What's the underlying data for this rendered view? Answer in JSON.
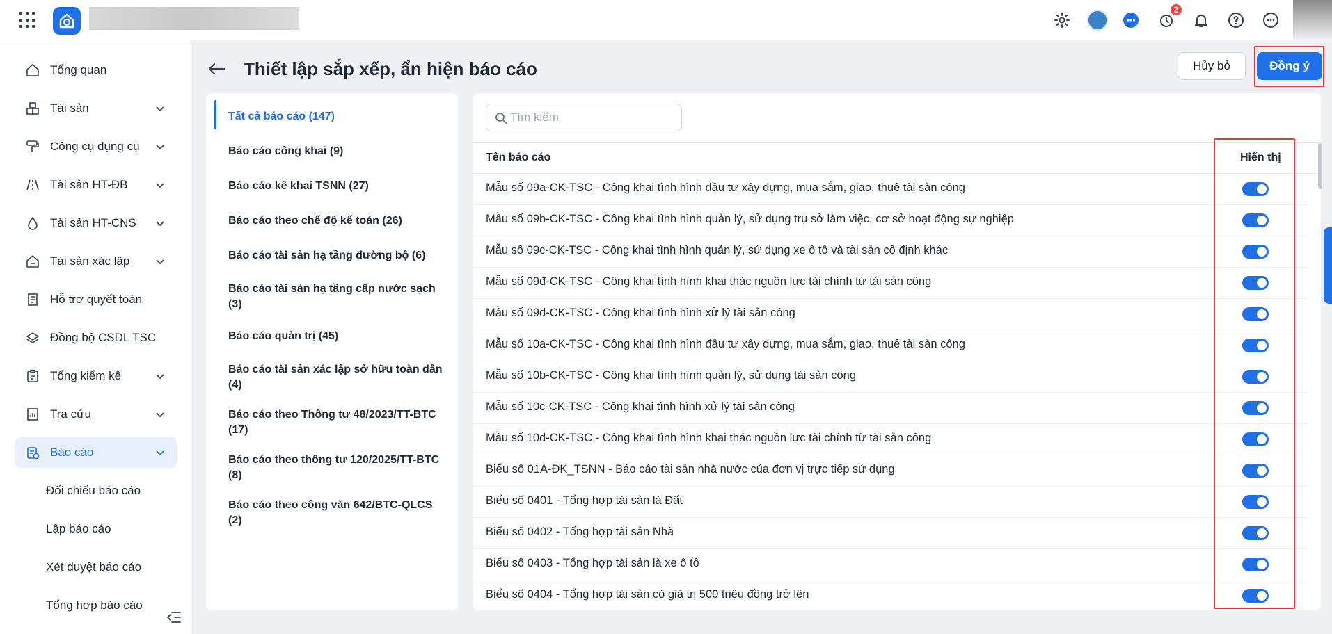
{
  "topbar": {
    "notification_count": "2",
    "icons": [
      "grid-icon",
      "app-logo",
      "settings-icon",
      "user-avatar",
      "chat-icon",
      "alarm-icon",
      "bell-icon",
      "help-icon",
      "more-icon"
    ]
  },
  "sidebar": {
    "items": [
      {
        "label": "Tổng quan",
        "icon": "home-icon",
        "has_chevron": false
      },
      {
        "label": "Tài sản",
        "icon": "cubes-icon",
        "has_chevron": true
      },
      {
        "label": "Công cụ dụng cụ",
        "icon": "paint-roller-icon",
        "has_chevron": true
      },
      {
        "label": "Tài sản HT-ĐB",
        "icon": "road-icon",
        "has_chevron": true
      },
      {
        "label": "Tài sản HT-CNS",
        "icon": "water-drop-icon",
        "has_chevron": true
      },
      {
        "label": "Tài sản xác lập",
        "icon": "home-outline-icon",
        "has_chevron": true
      },
      {
        "label": "Hỗ trợ quyết toán",
        "icon": "document-icon",
        "has_chevron": false
      },
      {
        "label": "Đồng bộ CSDL TSC",
        "icon": "layers-icon",
        "has_chevron": false
      },
      {
        "label": "Tổng kiểm kê",
        "icon": "clipboard-icon",
        "has_chevron": true
      },
      {
        "label": "Tra cứu",
        "icon": "chart-doc-icon",
        "has_chevron": true
      },
      {
        "label": "Báo cáo",
        "icon": "report-icon",
        "has_chevron": true,
        "active": true
      }
    ],
    "sub_items": [
      "Đối chiếu báo cáo",
      "Lập báo cáo",
      "Xét duyệt báo cáo",
      "Tổng hợp báo cáo"
    ]
  },
  "header": {
    "title": "Thiết lập sắp xếp, ẩn hiện báo cáo",
    "cancel_label": "Hủy bỏ",
    "ok_label": "Đồng ý"
  },
  "categories": [
    "Tất cả báo cáo (147)",
    "Báo cáo công khai (9)",
    "Báo cáo kê khai TSNN (27)",
    "Báo cáo theo chế độ kế toán (26)",
    "Báo cáo tài sản hạ tầng đường bộ (6)",
    "Báo cáo tài sản hạ tầng cấp nước sạch (3)",
    "Báo cáo quản trị (45)",
    "Báo cáo tài sản xác lập sở hữu toàn dân (4)",
    "Báo cáo theo Thông tư 48/2023/TT-BTC (17)",
    "Báo cáo theo thông tư 120/2025/TT-BTC (8)",
    "Báo cáo theo công văn 642/BTC-QLCS (2)"
  ],
  "search": {
    "placeholder": "Tìm kiếm",
    "value": ""
  },
  "table": {
    "col_name": "Tên báo cáo",
    "col_show": "Hiển thị",
    "rows": [
      {
        "name": "Mẫu số 09a-CK-TSC - Công khai tình hình đầu tư xây dựng, mua sắm, giao, thuê tài sản công",
        "visible": true
      },
      {
        "name": "Mẫu số 09b-CK-TSC - Công khai tình hình quản lý, sử dụng trụ sở làm việc, cơ sở hoạt động sự nghiệp",
        "visible": true
      },
      {
        "name": "Mẫu số 09c-CK-TSC - Công khai tình hình quản lý, sử dụng xe ô tô và tài sản cố định khác",
        "visible": true
      },
      {
        "name": "Mẫu số 09đ-CK-TSC - Công khai tình hình khai thác nguồn lực tài chính từ tài sản công",
        "visible": true
      },
      {
        "name": "Mẫu số 09d-CK-TSC - Công khai tình hình xử lý tài sản công",
        "visible": true
      },
      {
        "name": "Mẫu số 10a-CK-TSC - Công khai tình hình đầu tư xây dựng, mua sắm, giao, thuê tài sản công",
        "visible": true
      },
      {
        "name": "Mẫu số 10b-CK-TSC - Công khai tình hình quản lý, sử dụng tài sản công",
        "visible": true
      },
      {
        "name": "Mẫu số 10c-CK-TSC - Công khai tình hình xử lý tài sản công",
        "visible": true
      },
      {
        "name": "Mẫu số 10d-CK-TSC - Công khai tình hình khai thác nguồn lực tài chính từ tài sản công",
        "visible": true
      },
      {
        "name": "Biểu số 01A-ĐK_TSNN - Báo cáo tài sản nhà nước của đơn vị trực tiếp sử dụng",
        "visible": true
      },
      {
        "name": "Biểu số 0401 - Tổng hợp tài sản là Đất",
        "visible": true
      },
      {
        "name": "Biểu số 0402 - Tổng hợp tài sản Nhà",
        "visible": true
      },
      {
        "name": "Biểu số 0403 - Tổng hợp tài sản là xe ô tô",
        "visible": true
      },
      {
        "name": "Biểu số 0404 - Tổng hợp tài sản có giá trị 500 triệu đồng trở lên",
        "visible": true
      }
    ]
  }
}
